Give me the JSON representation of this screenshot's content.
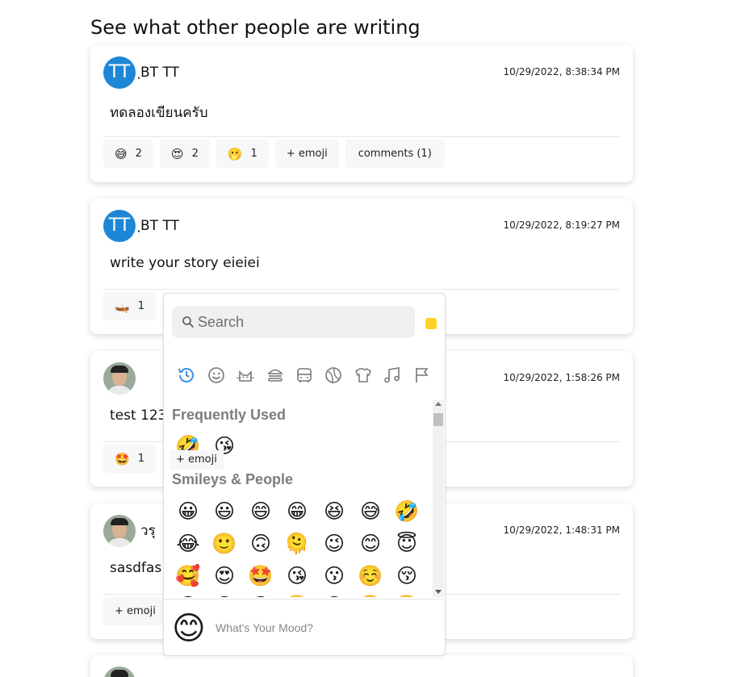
{
  "page": {
    "heading": "See what other people are writing"
  },
  "posts": [
    {
      "avatar_initials": "TT",
      "author": "ฺBT TT",
      "timestamp": "10/29/2022, 8:38:34 PM",
      "text": "ทดลองเขียนครับ",
      "reactions": [
        {
          "emoji": "😅",
          "count": "2"
        },
        {
          "emoji": "😍",
          "count": "2"
        },
        {
          "emoji": "🫢",
          "count": "1"
        }
      ],
      "add_emoji_label": "+ emoji",
      "comments_label": "comments (1)"
    },
    {
      "avatar_initials": "TT",
      "author": "ฺBT TT",
      "timestamp": "10/29/2022, 8:19:27 PM",
      "text": "write your story eieiei",
      "reactions": [
        {
          "emoji": "🛶",
          "count": "1"
        }
      ]
    },
    {
      "timestamp": "10/29/2022, 1:58:26 PM",
      "text": "test 123",
      "reactions": [
        {
          "emoji": "🤩",
          "count": "1"
        }
      ]
    },
    {
      "author": "วรุ",
      "timestamp": "10/29/2022, 1:48:31 PM",
      "text": "sasdfas",
      "add_emoji_label": "+ emoji"
    }
  ],
  "picker": {
    "search_placeholder": "Search",
    "tone_color": "#ffd225",
    "categories": [
      "recent-icon",
      "smileys-icon",
      "animals-icon",
      "food-icon",
      "travel-icon",
      "activity-icon",
      "objects-icon",
      "symbols-icon",
      "flags-icon"
    ],
    "frequent_title": "Frequently Used",
    "frequent": [
      "🤣",
      "😘"
    ],
    "smileys_title": "Smileys & People",
    "smileys": [
      [
        "😀",
        "😃",
        "😄",
        "😁",
        "😆",
        "😅",
        "🤣"
      ],
      [
        "😂",
        "🙂",
        "🙃",
        "🫠",
        "😉",
        "😊",
        "😇"
      ],
      [
        "🥰",
        "😍",
        "🤩",
        "😘",
        "😗",
        "☺️",
        "😚"
      ],
      [
        "😋",
        "😛",
        "😜",
        "🤪",
        "😝",
        "🤑",
        "🤗"
      ]
    ],
    "preview_emoji": "😊",
    "preview_text": "What's Your Mood?"
  },
  "overlay_chip": "+ emoji"
}
